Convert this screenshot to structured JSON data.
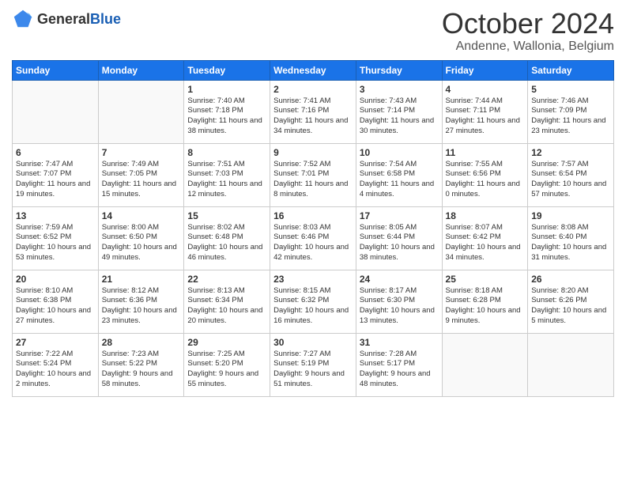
{
  "logo": {
    "general": "General",
    "blue": "Blue"
  },
  "title": {
    "month_year": "October 2024",
    "location": "Andenne, Wallonia, Belgium"
  },
  "weekdays": [
    "Sunday",
    "Monday",
    "Tuesday",
    "Wednesday",
    "Thursday",
    "Friday",
    "Saturday"
  ],
  "weeks": [
    [
      {
        "day": "",
        "info": ""
      },
      {
        "day": "",
        "info": ""
      },
      {
        "day": "1",
        "info": "Sunrise: 7:40 AM\nSunset: 7:18 PM\nDaylight: 11 hours and 38 minutes."
      },
      {
        "day": "2",
        "info": "Sunrise: 7:41 AM\nSunset: 7:16 PM\nDaylight: 11 hours and 34 minutes."
      },
      {
        "day": "3",
        "info": "Sunrise: 7:43 AM\nSunset: 7:14 PM\nDaylight: 11 hours and 30 minutes."
      },
      {
        "day": "4",
        "info": "Sunrise: 7:44 AM\nSunset: 7:11 PM\nDaylight: 11 hours and 27 minutes."
      },
      {
        "day": "5",
        "info": "Sunrise: 7:46 AM\nSunset: 7:09 PM\nDaylight: 11 hours and 23 minutes."
      }
    ],
    [
      {
        "day": "6",
        "info": "Sunrise: 7:47 AM\nSunset: 7:07 PM\nDaylight: 11 hours and 19 minutes."
      },
      {
        "day": "7",
        "info": "Sunrise: 7:49 AM\nSunset: 7:05 PM\nDaylight: 11 hours and 15 minutes."
      },
      {
        "day": "8",
        "info": "Sunrise: 7:51 AM\nSunset: 7:03 PM\nDaylight: 11 hours and 12 minutes."
      },
      {
        "day": "9",
        "info": "Sunrise: 7:52 AM\nSunset: 7:01 PM\nDaylight: 11 hours and 8 minutes."
      },
      {
        "day": "10",
        "info": "Sunrise: 7:54 AM\nSunset: 6:58 PM\nDaylight: 11 hours and 4 minutes."
      },
      {
        "day": "11",
        "info": "Sunrise: 7:55 AM\nSunset: 6:56 PM\nDaylight: 11 hours and 0 minutes."
      },
      {
        "day": "12",
        "info": "Sunrise: 7:57 AM\nSunset: 6:54 PM\nDaylight: 10 hours and 57 minutes."
      }
    ],
    [
      {
        "day": "13",
        "info": "Sunrise: 7:59 AM\nSunset: 6:52 PM\nDaylight: 10 hours and 53 minutes."
      },
      {
        "day": "14",
        "info": "Sunrise: 8:00 AM\nSunset: 6:50 PM\nDaylight: 10 hours and 49 minutes."
      },
      {
        "day": "15",
        "info": "Sunrise: 8:02 AM\nSunset: 6:48 PM\nDaylight: 10 hours and 46 minutes."
      },
      {
        "day": "16",
        "info": "Sunrise: 8:03 AM\nSunset: 6:46 PM\nDaylight: 10 hours and 42 minutes."
      },
      {
        "day": "17",
        "info": "Sunrise: 8:05 AM\nSunset: 6:44 PM\nDaylight: 10 hours and 38 minutes."
      },
      {
        "day": "18",
        "info": "Sunrise: 8:07 AM\nSunset: 6:42 PM\nDaylight: 10 hours and 34 minutes."
      },
      {
        "day": "19",
        "info": "Sunrise: 8:08 AM\nSunset: 6:40 PM\nDaylight: 10 hours and 31 minutes."
      }
    ],
    [
      {
        "day": "20",
        "info": "Sunrise: 8:10 AM\nSunset: 6:38 PM\nDaylight: 10 hours and 27 minutes."
      },
      {
        "day": "21",
        "info": "Sunrise: 8:12 AM\nSunset: 6:36 PM\nDaylight: 10 hours and 23 minutes."
      },
      {
        "day": "22",
        "info": "Sunrise: 8:13 AM\nSunset: 6:34 PM\nDaylight: 10 hours and 20 minutes."
      },
      {
        "day": "23",
        "info": "Sunrise: 8:15 AM\nSunset: 6:32 PM\nDaylight: 10 hours and 16 minutes."
      },
      {
        "day": "24",
        "info": "Sunrise: 8:17 AM\nSunset: 6:30 PM\nDaylight: 10 hours and 13 minutes."
      },
      {
        "day": "25",
        "info": "Sunrise: 8:18 AM\nSunset: 6:28 PM\nDaylight: 10 hours and 9 minutes."
      },
      {
        "day": "26",
        "info": "Sunrise: 8:20 AM\nSunset: 6:26 PM\nDaylight: 10 hours and 5 minutes."
      }
    ],
    [
      {
        "day": "27",
        "info": "Sunrise: 7:22 AM\nSunset: 5:24 PM\nDaylight: 10 hours and 2 minutes."
      },
      {
        "day": "28",
        "info": "Sunrise: 7:23 AM\nSunset: 5:22 PM\nDaylight: 9 hours and 58 minutes."
      },
      {
        "day": "29",
        "info": "Sunrise: 7:25 AM\nSunset: 5:20 PM\nDaylight: 9 hours and 55 minutes."
      },
      {
        "day": "30",
        "info": "Sunrise: 7:27 AM\nSunset: 5:19 PM\nDaylight: 9 hours and 51 minutes."
      },
      {
        "day": "31",
        "info": "Sunrise: 7:28 AM\nSunset: 5:17 PM\nDaylight: 9 hours and 48 minutes."
      },
      {
        "day": "",
        "info": ""
      },
      {
        "day": "",
        "info": ""
      }
    ]
  ]
}
